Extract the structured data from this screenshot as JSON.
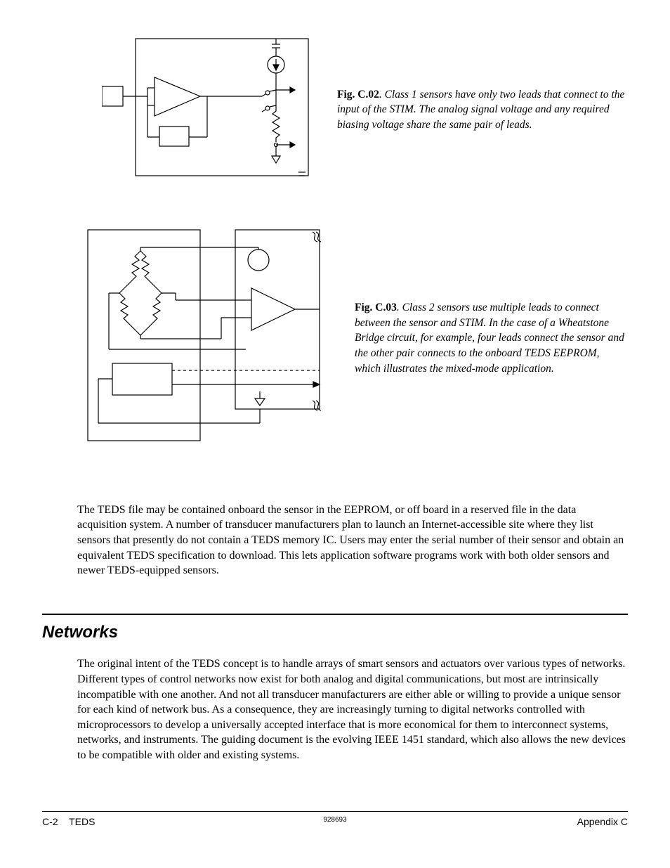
{
  "figures": {
    "c02": {
      "label": "Fig. C.02",
      "text": ". Class 1 sensors have only two leads that connect to the input of the STIM. The analog signal voltage and any required biasing voltage share the same pair of leads."
    },
    "c03": {
      "label": "Fig. C.03",
      "text": ". Class 2 sensors use multiple leads to connect between the sensor and STIM. In the case of a Wheatstone Bridge circuit, for example, four leads connect the sensor and the other pair connects to the onboard TEDS EEPROM, which illustrates the mixed-mode application."
    }
  },
  "paragraphs": {
    "teds_file": "The TEDS file may be contained onboard the sensor in the EEPROM, or off board in a reserved file in the data acquisition system. A number of transducer manufacturers plan to launch an Internet-accessible site where they list sensors that presently do not contain a TEDS memory IC. Users may enter the serial number of their sensor and obtain an equivalent TEDS specification to download. This lets application software programs work with both older sensors and newer TEDS-equipped sensors.",
    "networks": "The original intent of the TEDS concept is to handle arrays of smart sensors and actuators over various types of networks. Different types of control networks now exist for both analog and digital communications, but most are intrinsically incompatible with one another. And not all transducer manufacturers are either able or willing to provide a unique sensor for each kind of network bus. As a consequence, they are increasingly turning to digital networks controlled with microprocessors to develop a universally accepted interface that is more economical for them to interconnect systems, networks, and instruments. The guiding document is the evolving IEEE 1451 standard, which also allows the new devices to be compatible with older and existing systems."
  },
  "section": {
    "heading": "Networks"
  },
  "footer": {
    "left_page": "C-2",
    "left_title": "TEDS",
    "center": "928693",
    "right": "Appendix C"
  }
}
